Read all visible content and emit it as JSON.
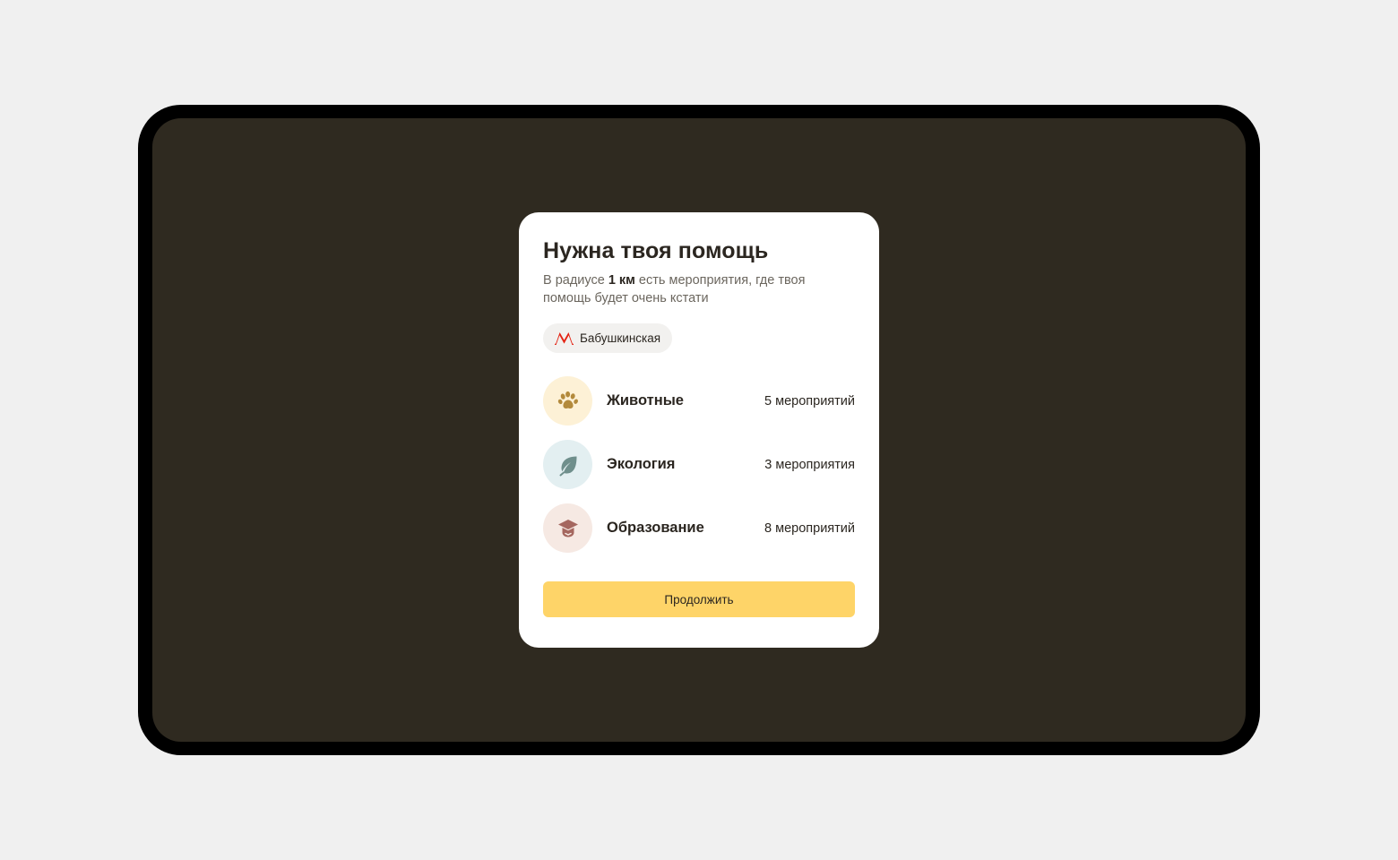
{
  "modal": {
    "title": "Нужна твоя помощь",
    "desc_prefix": "В радиусе ",
    "desc_bold": "1 км",
    "desc_suffix": " есть мероприятия, где твоя помощь будет очень кстати",
    "station": {
      "icon": "metro-icon",
      "label": "Бабушкинская"
    },
    "categories": [
      {
        "icon": "paw-icon",
        "label": "Животные",
        "count": "5 мероприятий",
        "bg": "#fdf1d6",
        "color": "#b38a3c"
      },
      {
        "icon": "leaf-icon",
        "label": "Экология",
        "count": "3 мероприятия",
        "bg": "#e3eff1",
        "color": "#6f8f8c"
      },
      {
        "icon": "graduation-cap-icon",
        "label": "Образование",
        "count": "8 мероприятий",
        "bg": "#f6e9e3",
        "color": "#a5675f"
      }
    ],
    "continue_label": "Продолжить"
  },
  "colors": {
    "page_bg": "#f0f0f0",
    "device_frame": "#000000",
    "screen_bg": "#2f2a20",
    "accent": "#fed468",
    "metro_red": "#e42313"
  }
}
